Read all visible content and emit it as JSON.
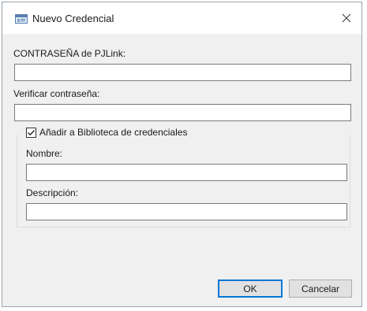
{
  "window": {
    "title": "Nuevo Credencial"
  },
  "icons": {
    "app": "credential-window-icon",
    "close": "close-icon",
    "check": "checkmark-icon"
  },
  "form": {
    "password_label": "CONTRASEÑA de PJLink:",
    "password_value": "",
    "verify_label": "Verificar contraseña:",
    "verify_value": "",
    "library_checkbox_label": "Añadir a Biblioteca de credenciales",
    "library_checked": true,
    "name_label": "Nombre:",
    "name_value": "",
    "description_label": "Descripción:",
    "description_value": ""
  },
  "buttons": {
    "ok": "OK",
    "cancel": "Cancelar"
  },
  "colors": {
    "accent": "#0078d7",
    "dialog_bg": "#f0f0f0",
    "titlebar_bg": "#ffffff"
  }
}
